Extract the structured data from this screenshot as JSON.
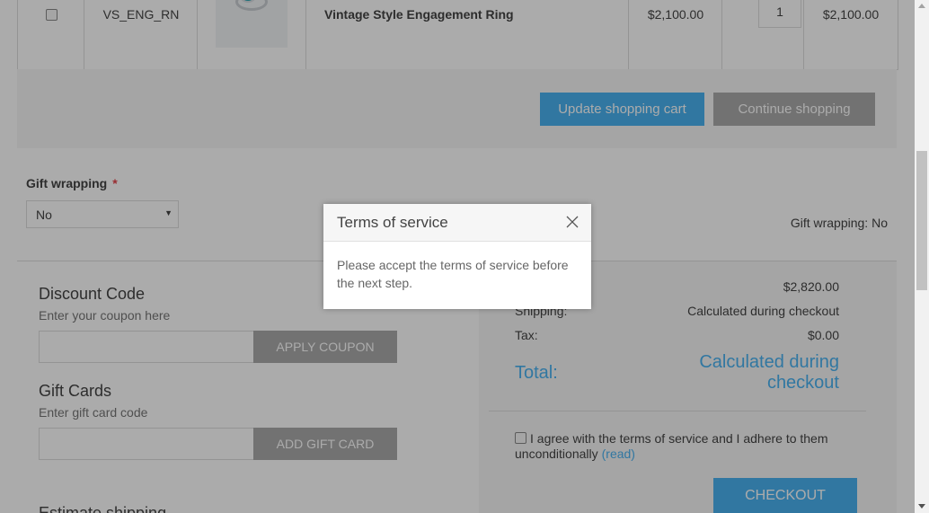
{
  "cart": {
    "item": {
      "sku": "VS_ENG_RN",
      "name": "Vintage Style Engagement Ring",
      "price": "$2,100.00",
      "quantity": "1",
      "total": "$2,100.00"
    },
    "update_label": "Update shopping cart",
    "continue_label": "Continue shopping"
  },
  "gift_wrapping": {
    "label": "Gift wrapping",
    "required_mark": "*",
    "selected": "No",
    "info": "Gift wrapping: No"
  },
  "discount": {
    "title": "Discount Code",
    "subtitle": "Enter your coupon here",
    "button": "APPLY COUPON"
  },
  "gift_cards": {
    "title": "Gift Cards",
    "subtitle": "Enter gift card code",
    "button": "ADD GIFT CARD"
  },
  "estimate": {
    "title": "Estimate shipping"
  },
  "totals": {
    "subtotal_value": "$2,820.00",
    "shipping_label": "Shipping:",
    "shipping_value": "Calculated during checkout",
    "tax_label": "Tax:",
    "tax_value": "$0.00",
    "total_label": "Total:",
    "total_value": "Calculated during checkout",
    "terms_text": "I agree with the terms of service and I adhere to them unconditionally",
    "read_link": "(read)",
    "checkout_label": "CHECKOUT"
  },
  "modal": {
    "title": "Terms of service",
    "body": "Please accept the terms of service before the next step."
  },
  "colors": {
    "accent": "#4ab2f1",
    "secondary_button": "#aaaaaa",
    "required": "#e4434b"
  }
}
